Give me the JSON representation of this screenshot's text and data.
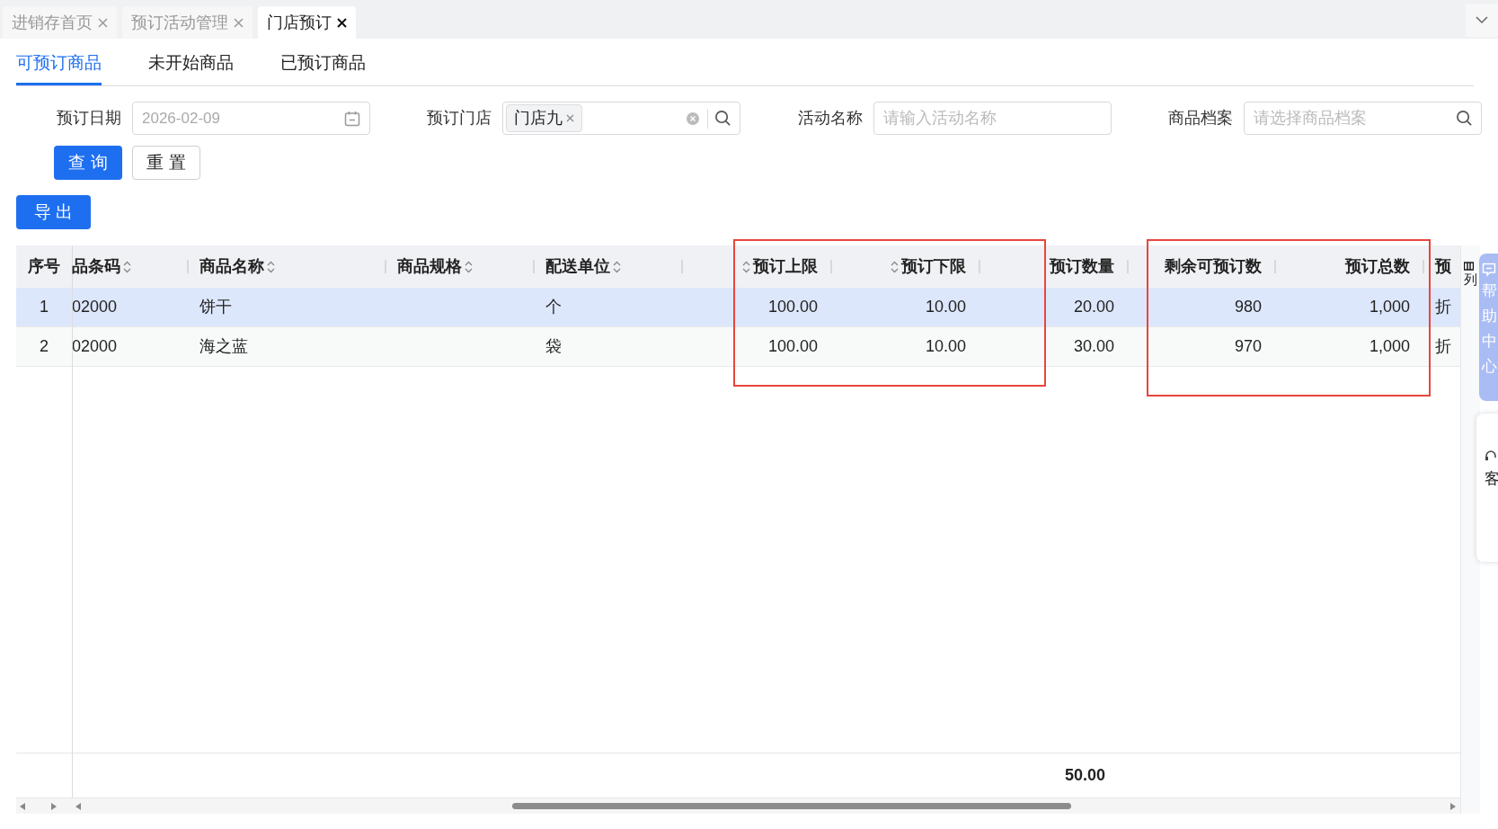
{
  "tabs": [
    {
      "label": "进销存首页",
      "selected": false
    },
    {
      "label": "预订活动管理",
      "selected": false
    },
    {
      "label": "门店预订",
      "selected": true
    }
  ],
  "sub_tabs": [
    {
      "label": "可预订商品",
      "selected": true
    },
    {
      "label": "未开始商品",
      "selected": false
    },
    {
      "label": "已预订商品",
      "selected": false
    }
  ],
  "filters": {
    "date": {
      "label": "预订日期",
      "value": "2026-02-09"
    },
    "store": {
      "label": "预订门店",
      "tag": "门店九"
    },
    "activity": {
      "label": "活动名称",
      "placeholder": "请输入活动名称"
    },
    "product": {
      "label": "商品档案",
      "placeholder": "请选择商品档案"
    }
  },
  "buttons": {
    "query": "查 询",
    "reset": "重 置",
    "export": "导 出"
  },
  "table": {
    "columns": [
      {
        "label": "序号",
        "sortable": false
      },
      {
        "label": "品条码",
        "sortable": true
      },
      {
        "label": "商品名称",
        "sortable": true
      },
      {
        "label": "商品规格",
        "sortable": true
      },
      {
        "label": "配送单位",
        "sortable": true
      },
      {
        "label": "预订上限",
        "sortable": true
      },
      {
        "label": "预订下限",
        "sortable": true
      },
      {
        "label": "预订数量",
        "sortable": false
      },
      {
        "label": "剩余可预订数",
        "sortable": false
      },
      {
        "label": "预订总数",
        "sortable": false
      },
      {
        "label": "预",
        "sortable": false
      }
    ],
    "rows": [
      {
        "selected": true,
        "cells": [
          "1",
          "02000",
          "饼干",
          null,
          "个",
          "100.00",
          "10.00",
          "20.00",
          "980",
          "1,000",
          "折"
        ]
      },
      {
        "selected": false,
        "cells": [
          "2",
          "02000",
          "海之蓝",
          null,
          "袋",
          "100.00",
          "10.00",
          "30.00",
          "970",
          "1,000",
          "折"
        ]
      }
    ],
    "total": "50.00"
  },
  "side": {
    "column_settings": "列",
    "help": "帮助中心",
    "service": "客"
  }
}
